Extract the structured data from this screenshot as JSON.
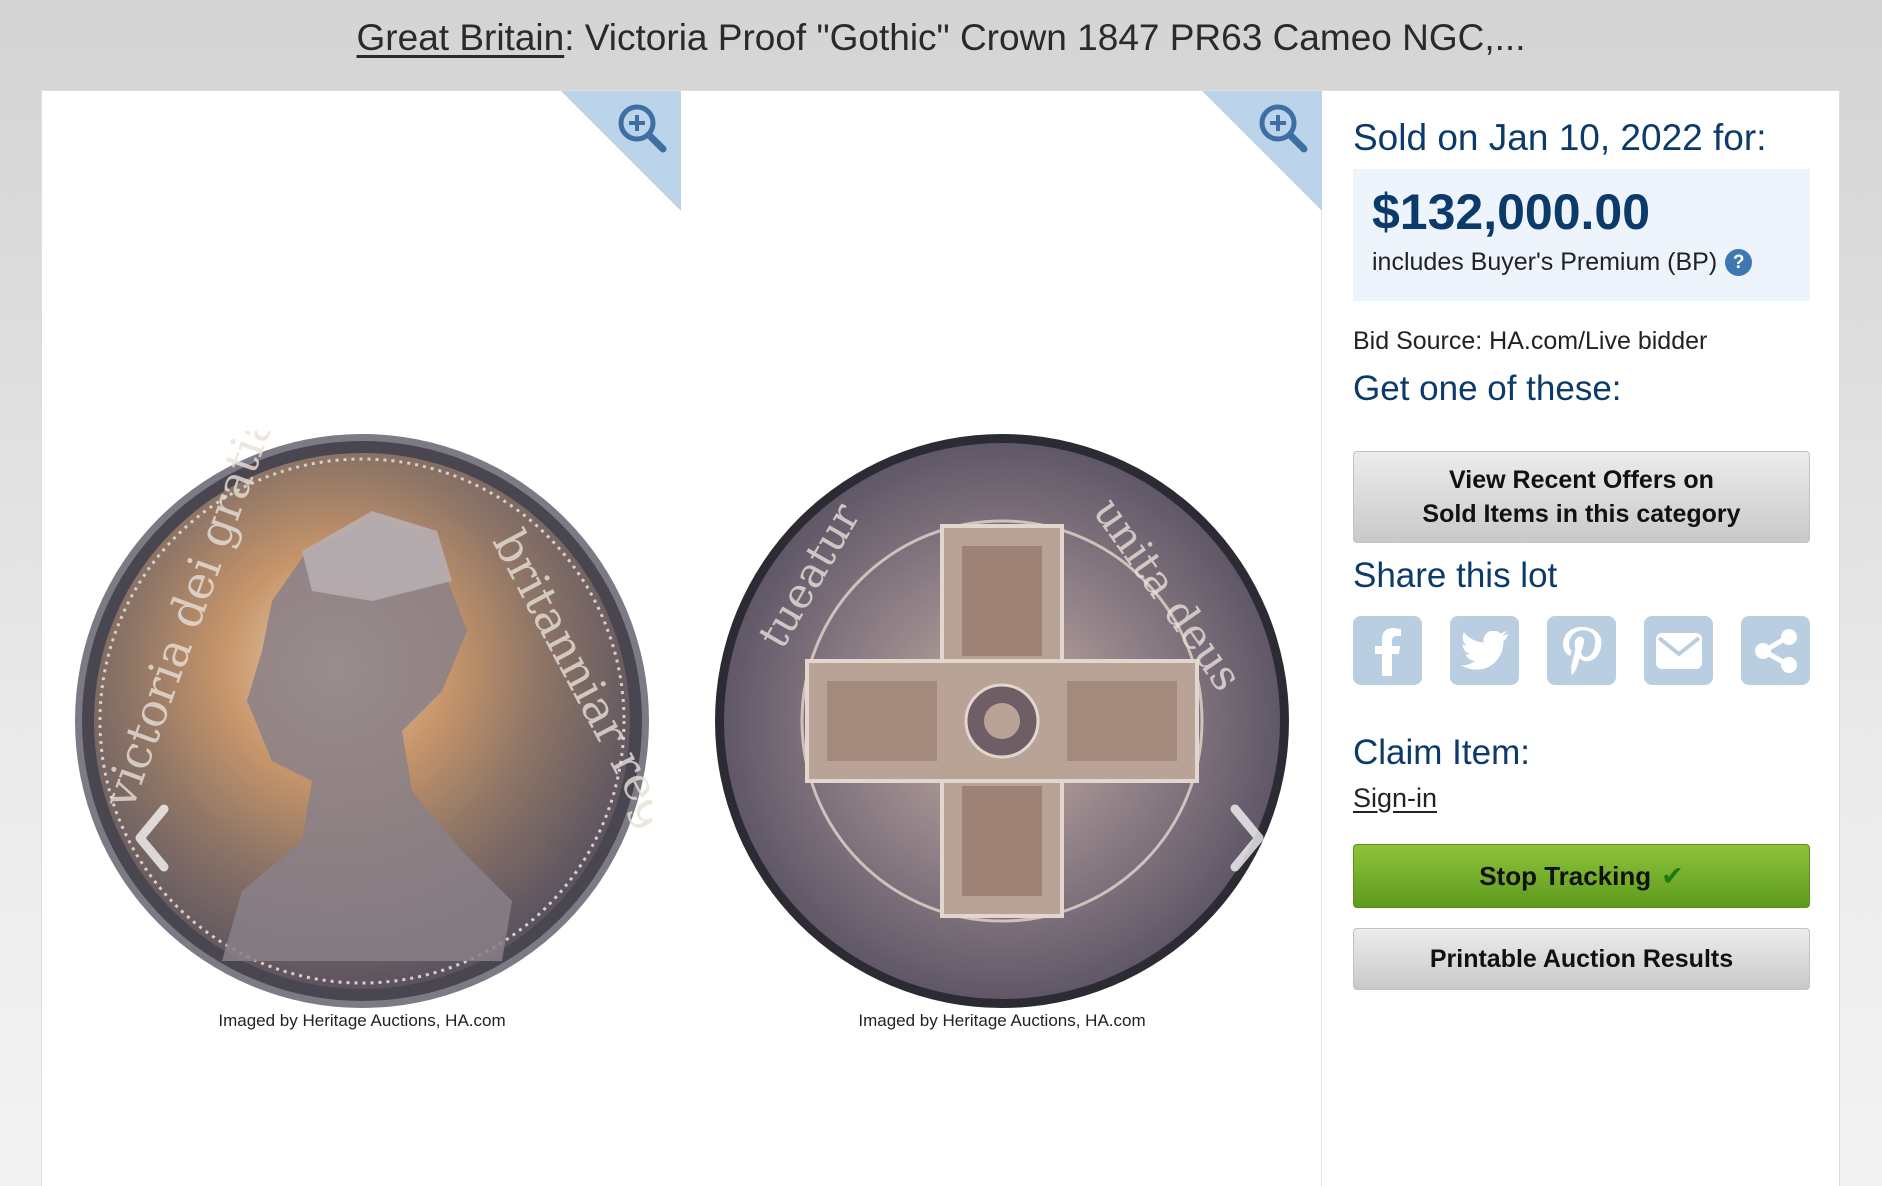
{
  "header": {
    "category_link": "Great Britain",
    "title_rest": ": Victoria Proof \"Gothic\" Crown 1847 PR63 Cameo NGC,..."
  },
  "images": {
    "obverse_credit": "Imaged by Heritage Auctions, HA.com",
    "reverse_credit": "Imaged by Heritage Auctions, HA.com",
    "zoom_icon": "zoom-in-icon"
  },
  "sale": {
    "sold_on": "Sold on Jan 10, 2022 for:",
    "price": "$132,000.00",
    "bp_note": "includes Buyer's Premium (BP)",
    "help_glyph": "?",
    "bid_source": "Bid Source: HA.com/Live bidder"
  },
  "get_one": {
    "title": "Get one of these:",
    "offers_button_line1": "View Recent Offers on",
    "offers_button_line2": "Sold Items in this category"
  },
  "share": {
    "title": "Share this lot",
    "buttons": [
      "facebook-icon",
      "twitter-icon",
      "pinterest-icon",
      "email-icon",
      "share-icon"
    ]
  },
  "claim": {
    "title": "Claim Item:",
    "sign_in": "Sign-in"
  },
  "actions": {
    "stop_tracking": "Stop Tracking",
    "check_glyph": "✔",
    "printable_results": "Printable Auction Results"
  },
  "colors": {
    "heading_blue": "#0c3a6a",
    "price_box_bg": "#edf4fb",
    "share_button_bg": "#b9cee1",
    "track_green": "#6fa82a"
  }
}
